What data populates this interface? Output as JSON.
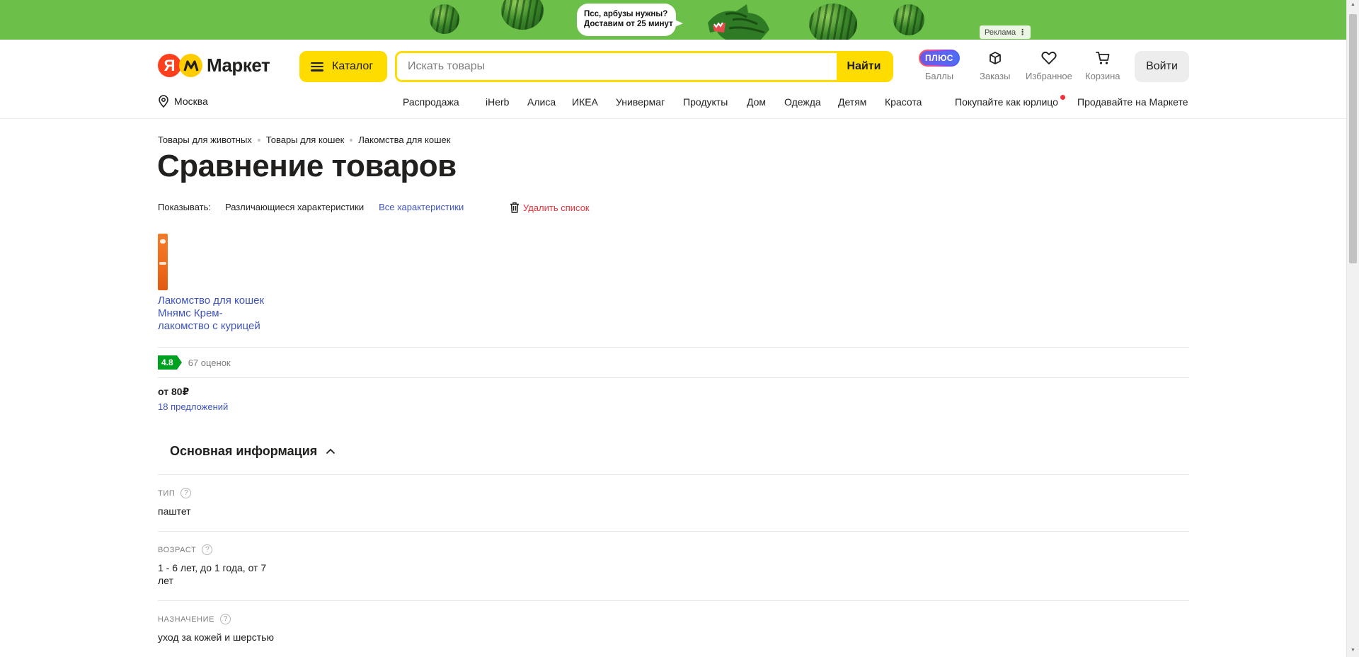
{
  "ad": {
    "bubble_line1": "Псс, арбузы нужны?",
    "bubble_line2": "Доставим от 25 минут",
    "label": "Реклама",
    "label_menu": "⋮",
    "bg_color": "#6cc04a"
  },
  "header": {
    "logo_ya": "Я",
    "logo_text": "Маркет",
    "catalog_label": "Каталог",
    "search_placeholder": "Искать товары",
    "search_button": "Найти",
    "plus_badge": "ПЛЮС",
    "points_label": "Баллы",
    "orders_label": "Заказы",
    "favorites_label": "Избранное",
    "cart_label": "Корзина",
    "login_label": "Войти",
    "city": "Москва",
    "nav": [
      "Распродажа",
      "iHerb",
      "Алиса",
      "ИКЕА",
      "Универмаг",
      "Продукты",
      "Дом",
      "Одежда",
      "Детям",
      "Красота"
    ],
    "business": "Покупайте как юрлицо",
    "sell": "Продавайте на Маркете",
    "accent_color": "#ffdc00"
  },
  "breadcrumbs": [
    "Товары для животных",
    "Товары для кошек",
    "Лакомства для кошек"
  ],
  "title": "Сравнение товаров",
  "show": {
    "label": "Показывать:",
    "option_active": "Различающиеся характеристики",
    "option_link": "Все характеристики",
    "delete": "Удалить список"
  },
  "product": {
    "name": "Лакомство для кошек Мнямс Крем-лакомство с курицей",
    "rating": "4.8",
    "reviews": "67 оценок",
    "price": "от 80₽",
    "offers": "18 предложений"
  },
  "section": {
    "title": "Основная информация",
    "specs": [
      {
        "label": "ТИП",
        "value": "паштет"
      },
      {
        "label": "ВОЗРАСТ",
        "value": "1 - 6 лет, до 1 года, от 7 лет"
      },
      {
        "label": "НАЗНАЧЕНИЕ",
        "value": "уход за кожей и шерстью"
      }
    ]
  },
  "icons": [
    "location-icon",
    "burger-icon",
    "box-icon",
    "heart-icon",
    "cart-icon",
    "trash-icon",
    "chevron-up-icon",
    "question-icon"
  ]
}
